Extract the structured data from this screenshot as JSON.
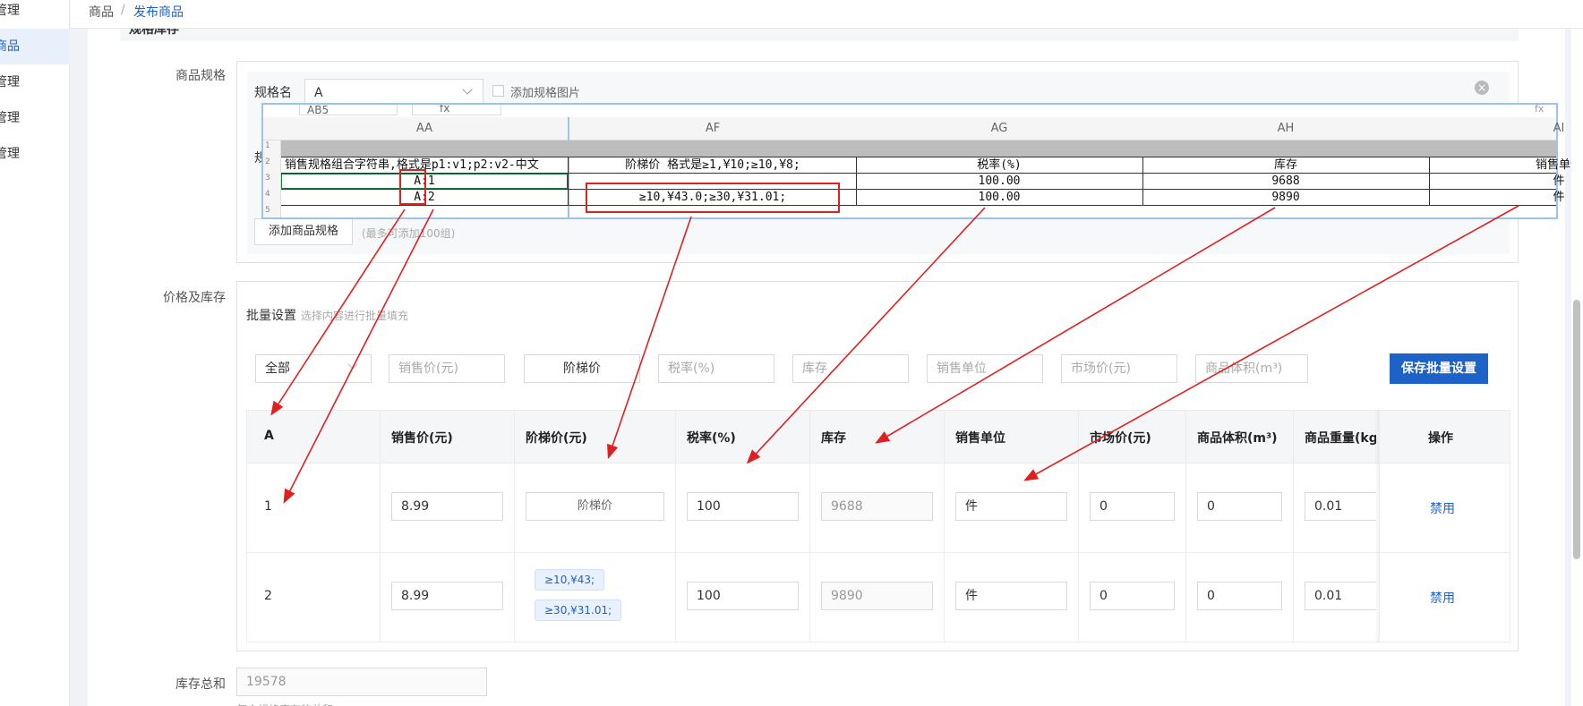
{
  "sidebar": {
    "items": [
      {
        "label": "管理",
        "active": false
      },
      {
        "label": "商品",
        "active": true
      },
      {
        "label": "管理",
        "active": false
      },
      {
        "label": "管理",
        "active": false
      },
      {
        "label": "管理",
        "active": false
      }
    ]
  },
  "breadcrumb": {
    "root": "商品",
    "separator": "/",
    "current": "发布商品"
  },
  "section_title": "规格库存",
  "spec": {
    "label": "商品规格",
    "name_label": "规格名",
    "name_value": "A",
    "add_image_label": "添加规格图片",
    "add_spec_button": "添加商品规格",
    "add_spec_hint": "(最多可添加100组)"
  },
  "spreadsheet": {
    "toolbar_cell": "AB5",
    "columns": [
      "AA",
      "AF",
      "AG",
      "AH",
      "AI"
    ],
    "rows": [
      "1",
      "2",
      "3",
      "4",
      "5"
    ],
    "header_row": [
      "销售规格组合字符串,格式是p1:v1;p2:v2-中文",
      "阶梯价 格式是≥1,¥10;≥10,¥8;",
      "税率(%)",
      "库存",
      "销售单位"
    ],
    "data_rows": [
      [
        "A:1",
        "",
        "100.00",
        "9688",
        "件"
      ],
      [
        "A:2",
        "≥10,¥43.0;≥30,¥31.01;",
        "100.00",
        "9890",
        "件"
      ]
    ]
  },
  "price_stock": {
    "label": "价格及库存",
    "batch_label": "批量设置",
    "batch_hint": "选择内容进行批量填充",
    "filters": {
      "scope": "全部",
      "sale_price": "销售价(元)",
      "tier_price": "阶梯价",
      "tax_rate": "税率(%)",
      "stock": "库存",
      "sale_unit": "销售单位",
      "market_price": "市场价(元)",
      "volume": "商品体积(m³)"
    },
    "save_button": "保存批量设置",
    "table": {
      "headers": [
        "A",
        "销售价(元)",
        "阶梯价(元)",
        "税率(%)",
        "库存",
        "销售单位",
        "市场价(元)",
        "商品体积(m³)",
        "商品重量(kg)",
        "操作"
      ],
      "rows": [
        {
          "a": "1",
          "sale_price": "8.99",
          "tier_button": "阶梯价",
          "tax_rate": "100",
          "stock": "9688",
          "unit": "件",
          "market": "0",
          "volume": "0",
          "weight": "0.01",
          "action": "禁用"
        },
        {
          "a": "2",
          "sale_price": "8.99",
          "tiers": [
            "≥10,¥43;",
            "≥30,¥31.01;"
          ],
          "tax_rate": "100",
          "stock": "9890",
          "unit": "件",
          "market": "0",
          "volume": "0",
          "weight": "0.01",
          "action": "禁用"
        }
      ]
    }
  },
  "stock_total": {
    "label": "库存总和",
    "value": "19578",
    "hint": "每个规格库存的总和"
  },
  "colors": {
    "primary": "#1d62c6",
    "annotation": "#e02020"
  }
}
